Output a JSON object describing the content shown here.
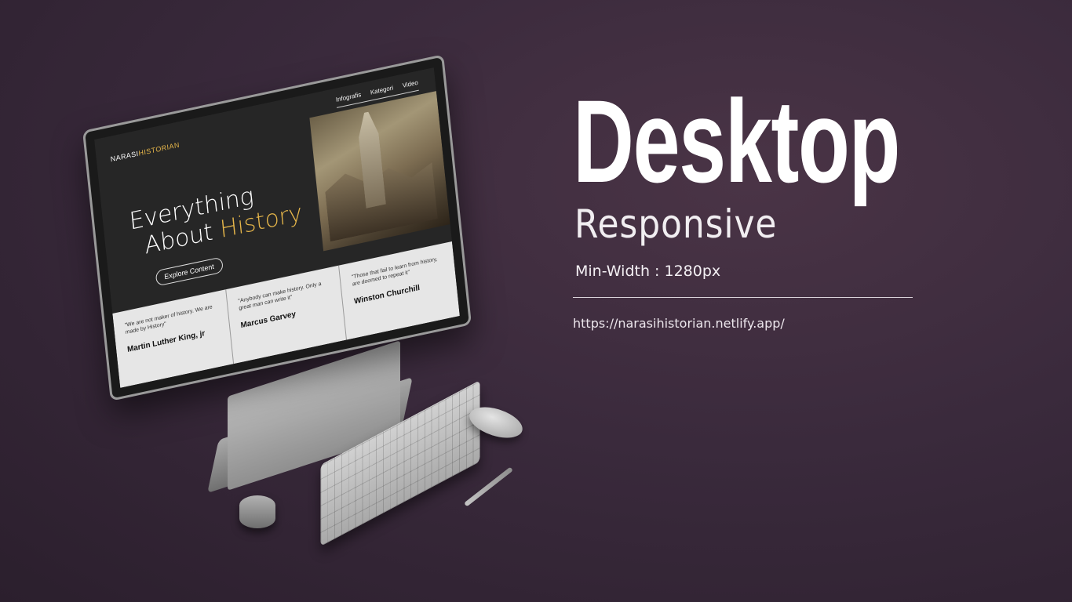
{
  "heading": {
    "title": "Desktop",
    "subtitle": "Responsive",
    "min_width": "Min-Width : 1280px",
    "url": "https://narasihistorian.netlify.app/"
  },
  "site": {
    "logo_part1": "NARASI",
    "logo_part2": "HISTORIAN",
    "nav": [
      "Infografis",
      "Kategori",
      "Video"
    ],
    "headline_line1": "Everything",
    "headline_line2a": "About ",
    "headline_line2b": "History",
    "cta": "Explore Content",
    "quotes": [
      {
        "quote": "\"We are not maker of history. We are made by History\"",
        "author": "Martin Luther King, jr"
      },
      {
        "quote": "\"Anybody can make history. Only a great man can write it\"",
        "author": "Marcus Garvey"
      },
      {
        "quote": "\"Those that fail to learn from history, are doomed to repeat it\"",
        "author": "Winston Churchill"
      }
    ]
  },
  "colors": {
    "accent": "#e6b64a",
    "background": "#3a2a3c"
  }
}
